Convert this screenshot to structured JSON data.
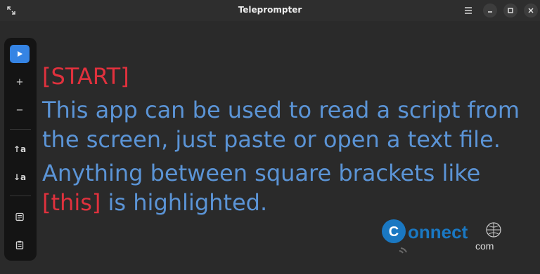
{
  "window": {
    "title": "Teleprompter"
  },
  "icons": {
    "expand": "expand-icon",
    "menu": "hamburger-menu-icon",
    "minimize": "minimize-icon",
    "maximize": "maximize-icon",
    "close": "close-icon",
    "play": "play-icon",
    "zoom_in": "plus-icon",
    "zoom_out": "minus-icon",
    "scroll_up": "text-up-icon",
    "scroll_down": "text-down-icon",
    "open": "open-file-icon",
    "paste": "paste-icon"
  },
  "sidebar": {
    "plus": "+",
    "minus": "−",
    "font_up": "↑a",
    "font_down": "↓a"
  },
  "script": {
    "line1": "[START]",
    "line2": "This app can be used to read a script from the screen, just paste or open a text file.",
    "line3_a": "Anything between square brackets like ",
    "line3_hl": "[this]",
    "line3_b": " is highlighted."
  },
  "watermark": {
    "brand_left": "C",
    "brand_main": "onnect",
    "brand_sub": "com"
  },
  "colors": {
    "accent": "#3584e4",
    "script_text": "#5b94d6",
    "highlight": "#e0313d",
    "background": "#2a2a2a"
  }
}
